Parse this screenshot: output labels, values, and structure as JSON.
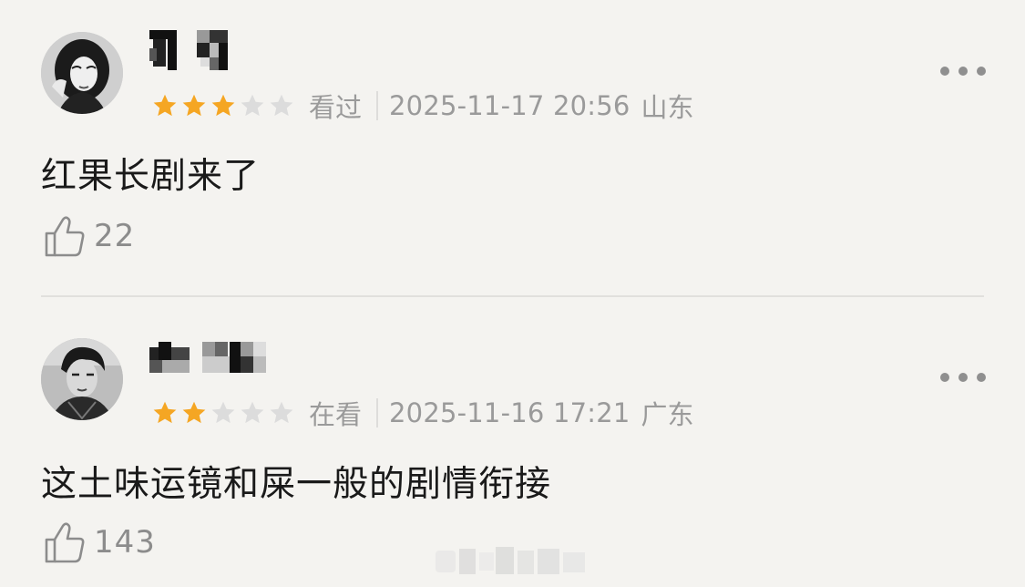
{
  "reviews": [
    {
      "username": "",
      "rating": 3,
      "max_rating": 5,
      "status": "看过",
      "timestamp": "2025-11-17 20:56",
      "location": "山东",
      "content": "红果长剧来了",
      "likes": "22"
    },
    {
      "username": "",
      "rating": 2,
      "max_rating": 5,
      "status": "在看",
      "timestamp": "2025-11-16 17:21",
      "location": "广东",
      "content": "这土味运镜和屎一般的剧情衔接",
      "likes": "143"
    }
  ],
  "colors": {
    "background": "#f4f3f0",
    "star_filled": "#f5a623",
    "star_empty": "#dcdcdc",
    "meta_text": "#9a9a9a",
    "content_text": "#1a1a1a"
  },
  "icons": {
    "more": "more-horizontal-icon",
    "like": "thumbs-up-icon",
    "star": "star-icon"
  }
}
